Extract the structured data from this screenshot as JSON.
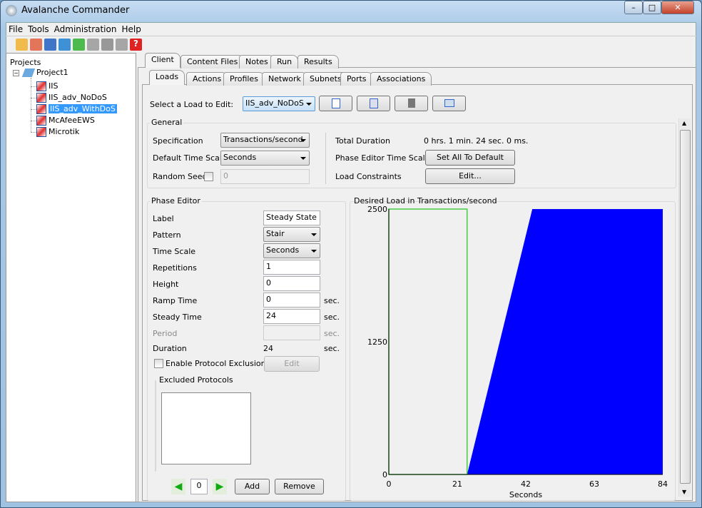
{
  "window": {
    "title": "Avalanche Commander",
    "minimize": "–",
    "maximize": "□",
    "close": "✕"
  },
  "menu": [
    "File",
    "Tools",
    "Administration",
    "Help"
  ],
  "toolbar": [
    "new-project-icon",
    "new-test-icon",
    "save-icon",
    "validate-icon",
    "run-icon",
    "next-icon",
    "stop-icon",
    "upload-icon",
    "help-icon"
  ],
  "tree": {
    "header": "Projects",
    "project": "Project1",
    "items": [
      "IIS",
      "IIS_adv_NoDoS",
      "IIS_adv_WithDoS",
      "McAfeeEWS",
      "Microtik"
    ],
    "selected": "IIS_adv_WithDoS"
  },
  "tabs_top": [
    "Client",
    "Content Files",
    "Notes",
    "Run",
    "Results"
  ],
  "tabs_sub": [
    "Loads",
    "Actions",
    "Profiles",
    "Network",
    "Subnets",
    "Ports",
    "Associations"
  ],
  "load_select": {
    "label": "Select a Load to Edit:",
    "value": "IIS_adv_NoDoS"
  },
  "general": {
    "title": "General",
    "spec_label": "Specification",
    "spec_value": "Transactions/second",
    "timescale_label": "Default Time Scale",
    "timescale_value": "Seconds",
    "seed_label": "Random Seed",
    "seed_value": "0",
    "total_label": "Total Duration",
    "total_value": "0 hrs. 1 min. 24 sec. 0 ms.",
    "pets_label": "Phase Editor Time Scales",
    "pets_button": "Set All To Default",
    "lc_label": "Load Constraints",
    "lc_button": "Edit..."
  },
  "phase": {
    "title": "Phase Editor",
    "label_l": "Label",
    "label_v": "Steady State",
    "pattern_l": "Pattern",
    "pattern_v": "Stair",
    "ts_l": "Time Scale",
    "ts_v": "Seconds",
    "rep_l": "Repetitions",
    "rep_v": "1",
    "height_l": "Height",
    "height_v": "0",
    "ramp_l": "Ramp Time",
    "ramp_v": "0",
    "steady_l": "Steady Time",
    "steady_v": "24",
    "period_l": "Period",
    "period_v": "",
    "dur_l": "Duration",
    "dur_v": "24",
    "unit": "sec.",
    "excl_l": "Enable Protocol Exclusion",
    "excl_edit": "Edit",
    "excl_group": "Excluded Protocols",
    "index": "0",
    "add": "Add",
    "remove": "Remove"
  },
  "chart_data": {
    "type": "area",
    "title": "Desired Load in Transactions/second",
    "xlabel": "Seconds",
    "ylabel": "",
    "xlim": [
      0,
      84
    ],
    "ylim": [
      0,
      2500
    ],
    "xticks": [
      "0",
      "21",
      "42",
      "63",
      "84"
    ],
    "yticks": [
      "0",
      "1250",
      "2500"
    ],
    "x": [
      0,
      24,
      44,
      84
    ],
    "y": [
      0,
      0,
      2500,
      2500
    ],
    "fill_color": "#0000ff",
    "selected_phase": {
      "x": [
        0,
        24
      ],
      "color": "#44cc44"
    }
  }
}
